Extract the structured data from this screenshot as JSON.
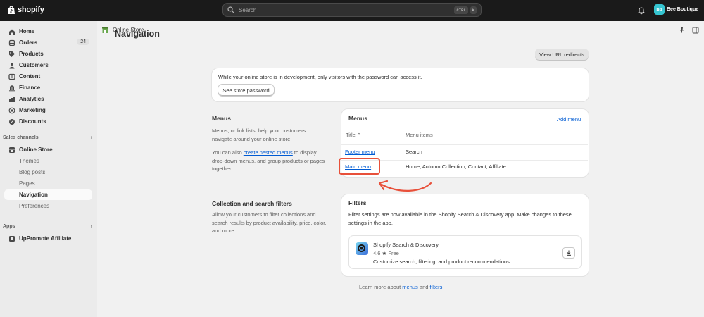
{
  "topbar": {
    "brand": "shopify",
    "search_placeholder": "Search",
    "kbd_ctrl": "CTRL",
    "kbd_k": "K",
    "store_initials": "BB",
    "store_name": "Bee Boutique"
  },
  "sidebar": {
    "items": [
      {
        "label": "Home",
        "icon": "home-icon"
      },
      {
        "label": "Orders",
        "icon": "orders-icon",
        "badge": "24"
      },
      {
        "label": "Products",
        "icon": "tag-icon"
      },
      {
        "label": "Customers",
        "icon": "person-icon"
      },
      {
        "label": "Content",
        "icon": "content-icon"
      },
      {
        "label": "Finance",
        "icon": "bank-icon"
      },
      {
        "label": "Analytics",
        "icon": "analytics-icon"
      },
      {
        "label": "Marketing",
        "icon": "target-icon"
      },
      {
        "label": "Discounts",
        "icon": "discount-icon"
      }
    ],
    "sales_channels_header": "Sales channels",
    "online_store": "Online Store",
    "sub_items": [
      "Themes",
      "Blog posts",
      "Pages",
      "Navigation",
      "Preferences"
    ],
    "apps_header": "Apps",
    "app_item": "UpPromote Affiliate"
  },
  "breadcrumb": {
    "label": "Online Store"
  },
  "page": {
    "title": "Navigation",
    "view_redirects": "View URL redirects"
  },
  "password_banner": {
    "text": "While your online store is in development, only visitors with the password can access it.",
    "button": "See store password"
  },
  "menus_section": {
    "heading": "Menus",
    "desc1": "Menus, or link lists, help your customers navigate around your online store.",
    "desc2_pre": "You can also ",
    "desc2_link": "create nested menus",
    "desc2_post": " to display drop-down menus, and group products or pages together."
  },
  "menus_card": {
    "title": "Menus",
    "add_menu": "Add menu",
    "col_title": "Title",
    "col_items": "Menu items",
    "rows": [
      {
        "title": "Footer menu",
        "items": "Search"
      },
      {
        "title": "Main menu",
        "items": "Home, Autumn Collection, Contact, Affiliate"
      }
    ]
  },
  "filters_section": {
    "heading": "Collection and search filters",
    "desc": "Allow your customers to filter collections and search results by product availability, price, color, and more."
  },
  "filters_card": {
    "title": "Filters",
    "text": "Filter settings are now available in the Shopify Search & Discovery app. Make changes to these settings in the app.",
    "app_name": "Shopify Search & Discovery",
    "rating": "4.6",
    "price": "Free",
    "app_desc": "Customize search, filtering, and product recommendations"
  },
  "footer": {
    "pre": "Learn more about ",
    "link1": "menus",
    "mid": " and ",
    "link2": "filters"
  },
  "colors": {
    "accent_link": "#005bd3",
    "highlight": "#e8503a",
    "store_badge": "#36c5d1"
  }
}
